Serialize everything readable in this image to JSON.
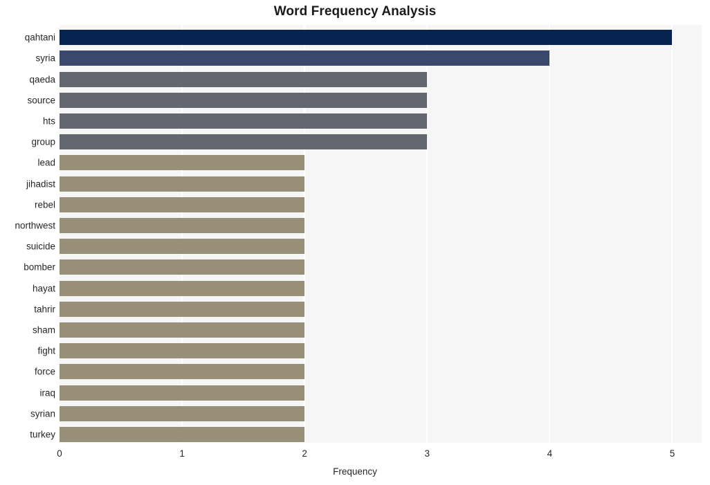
{
  "chart_data": {
    "type": "bar",
    "orientation": "horizontal",
    "title": "Word Frequency Analysis",
    "xlabel": "Frequency",
    "ylabel": "",
    "categories": [
      "qahtani",
      "syria",
      "qaeda",
      "source",
      "hts",
      "group",
      "lead",
      "jihadist",
      "rebel",
      "northwest",
      "suicide",
      "bomber",
      "hayat",
      "tahrir",
      "sham",
      "fight",
      "force",
      "iraq",
      "syrian",
      "turkey"
    ],
    "values": [
      5,
      4,
      3,
      3,
      3,
      3,
      2,
      2,
      2,
      2,
      2,
      2,
      2,
      2,
      2,
      2,
      2,
      2,
      2,
      2
    ],
    "bar_colors": [
      "#07234f",
      "#39486c",
      "#64676f",
      "#64676f",
      "#64676f",
      "#64676f",
      "#978f78",
      "#978f78",
      "#978f78",
      "#978f78",
      "#978f78",
      "#978f78",
      "#978f78",
      "#978f78",
      "#978f78",
      "#978f78",
      "#978f78",
      "#978f78",
      "#978f78",
      "#978f78"
    ],
    "xticks": [
      0,
      1,
      2,
      3,
      4,
      5
    ],
    "xtick_labels": [
      "0",
      "1",
      "2",
      "3",
      "4",
      "5"
    ],
    "xlim": [
      0,
      5.24
    ],
    "grid": true,
    "grid_axis": "x",
    "legend": false,
    "plot_background": "#f6f6f7",
    "grid_color": "#ffffff",
    "figure_background": "#ffffff"
  }
}
